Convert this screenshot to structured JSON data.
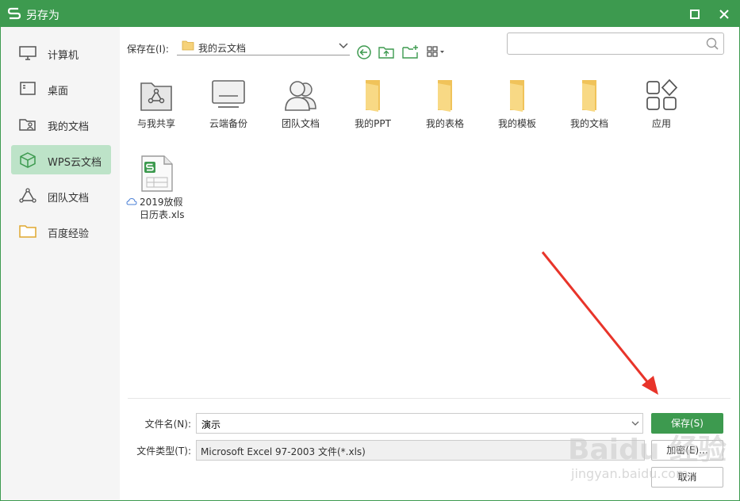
{
  "window": {
    "title": "另存为"
  },
  "sidebar": {
    "items": [
      {
        "label": "计算机",
        "icon": "monitor-icon"
      },
      {
        "label": "桌面",
        "icon": "desktop-icon"
      },
      {
        "label": "我的文档",
        "icon": "user-folder-icon"
      },
      {
        "label": "WPS云文档",
        "icon": "cube-icon",
        "active": true
      },
      {
        "label": "团队文档",
        "icon": "team-icon"
      },
      {
        "label": "百度经验",
        "icon": "folder-icon"
      }
    ]
  },
  "toolbar": {
    "save_in_label": "保存在(I):",
    "path": "我的云文档",
    "search_placeholder": ""
  },
  "items": [
    {
      "label": "与我共享",
      "icon": "share-folder-icon"
    },
    {
      "label": "云端备份",
      "icon": "cloud-backup-icon"
    },
    {
      "label": "团队文档",
      "icon": "team-docs-icon"
    },
    {
      "label": "我的PPT",
      "icon": "folder-icon"
    },
    {
      "label": "我的表格",
      "icon": "folder-icon"
    },
    {
      "label": "我的模板",
      "icon": "folder-icon"
    },
    {
      "label": "我的文档",
      "icon": "folder-icon"
    },
    {
      "label": "应用",
      "icon": "apps-icon"
    }
  ],
  "file": {
    "line1": "2019放假",
    "line2": "日历表.xls"
  },
  "form": {
    "filename_label": "文件名(N):",
    "filename_value": "演示",
    "filetype_label": "文件类型(T):",
    "filetype_value": "Microsoft Excel 97-2003 文件(*.xls)",
    "save_button": "保存(S)",
    "encrypt_button": "加密(E)...",
    "cancel_button": "取消"
  },
  "watermark": {
    "text": "Baidu 经验",
    "sub": "jingyan.baidu.com"
  },
  "colors": {
    "accent": "#3d9a4f",
    "active_bg": "#bde3c8",
    "folder": "#f6d27a",
    "arrow": "#e8342a"
  }
}
